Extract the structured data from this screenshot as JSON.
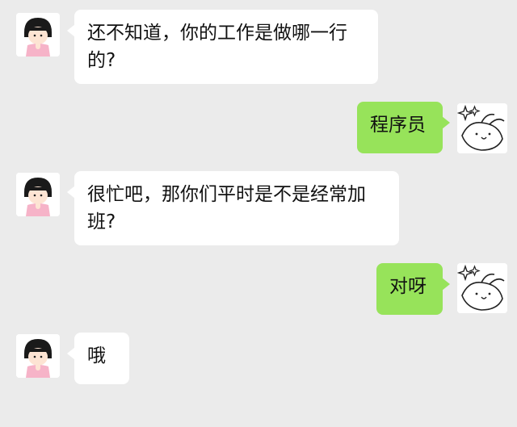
{
  "chat": {
    "messages": [
      {
        "side": "left",
        "text": "还不知道，你的工作是做哪一行的?"
      },
      {
        "side": "right",
        "text": "程序员"
      },
      {
        "side": "left",
        "text": "很忙吧，那你们平时是不是经常加班?"
      },
      {
        "side": "right",
        "text": "对呀"
      },
      {
        "side": "left",
        "text": "哦"
      }
    ],
    "avatars": {
      "left": "girl-avatar-icon",
      "right": "bunny-avatar-icon"
    }
  },
  "colors": {
    "background": "#ebebeb",
    "incoming_bubble": "#ffffff",
    "outgoing_bubble": "#97e35a"
  }
}
